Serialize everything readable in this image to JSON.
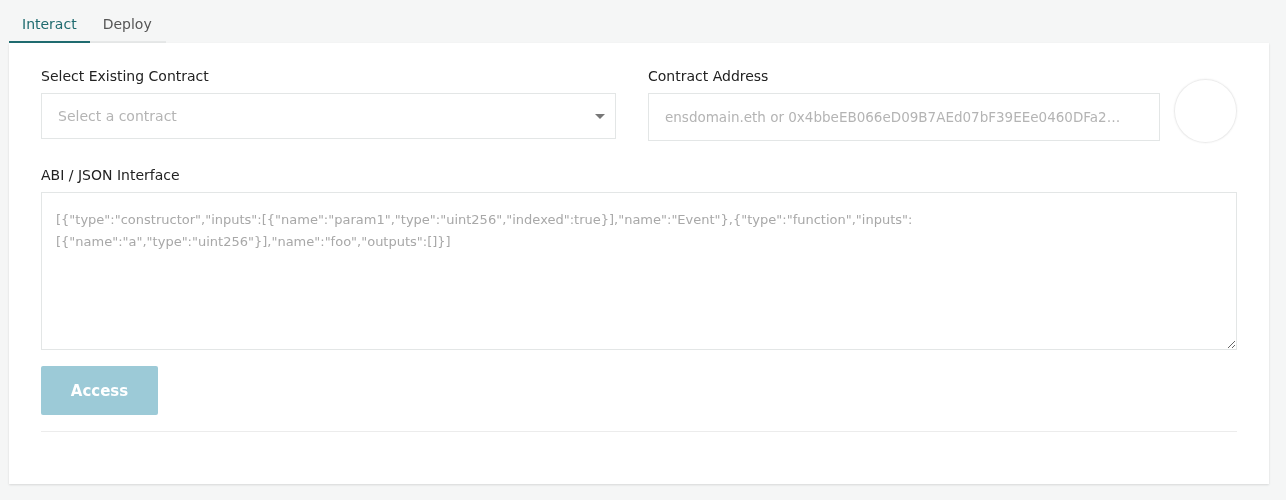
{
  "tabs": [
    {
      "label": "Interact",
      "selected": true
    },
    {
      "label": "Deploy",
      "selected": false
    }
  ],
  "contract_select": {
    "label": "Select Existing Contract",
    "placeholder": "Select a contract"
  },
  "contract_address": {
    "label": "Contract Address",
    "placeholder": "ensdomain.eth or 0x4bbeEB066eD09B7AEd07bF39EEe0460DFa2…"
  },
  "abi": {
    "label": "ABI / JSON Interface",
    "placeholder": "[{\"type\":\"constructor\",\"inputs\":[{\"name\":\"param1\",\"type\":\"uint256\",\"indexed\":true}],\"name\":\"Event\"},{\"type\":\"function\",\"inputs\": [{\"name\":\"a\",\"type\":\"uint256\"}],\"name\":\"foo\",\"outputs\":[]}]"
  },
  "access_button": {
    "label": "Access",
    "disabled": true
  }
}
